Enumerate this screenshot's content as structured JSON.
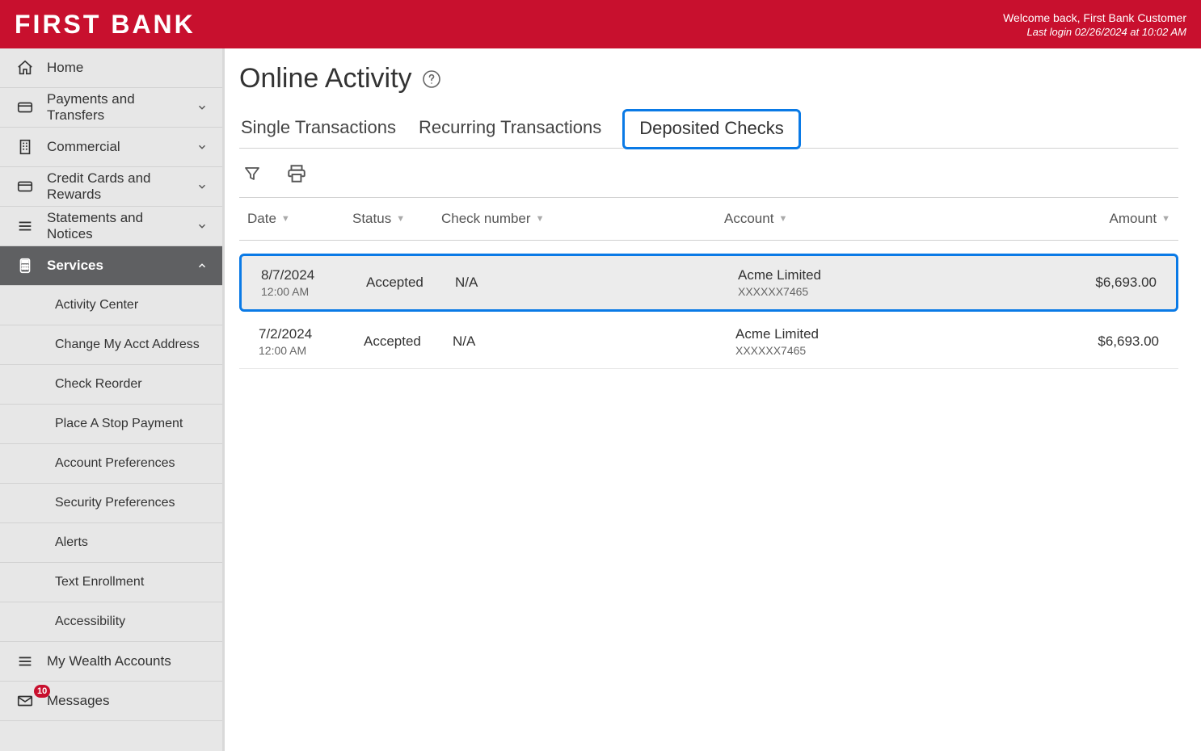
{
  "brand": "FIRST BANK",
  "header": {
    "welcome": "Welcome back, First Bank Customer",
    "last_login": "Last login 02/26/2024 at 10:02 AM"
  },
  "sidebar": {
    "items": [
      {
        "id": "home",
        "label": "Home",
        "icon": "home",
        "expandable": false
      },
      {
        "id": "payments",
        "label": "Payments and Transfers",
        "icon": "card",
        "expandable": true,
        "expanded": false
      },
      {
        "id": "commercial",
        "label": "Commercial",
        "icon": "building",
        "expandable": true,
        "expanded": false
      },
      {
        "id": "credit",
        "label": "Credit Cards and Rewards",
        "icon": "card",
        "expandable": true,
        "expanded": false
      },
      {
        "id": "statements",
        "label": "Statements and Notices",
        "icon": "lines",
        "expandable": true,
        "expanded": false
      },
      {
        "id": "services",
        "label": "Services",
        "icon": "calculator",
        "expandable": true,
        "expanded": true,
        "active": true,
        "children": [
          {
            "id": "activity-center",
            "label": "Activity Center"
          },
          {
            "id": "change-address",
            "label": "Change My Acct Address"
          },
          {
            "id": "check-reorder",
            "label": "Check Reorder"
          },
          {
            "id": "stop-payment",
            "label": "Place A Stop Payment"
          },
          {
            "id": "acct-pref",
            "label": "Account Preferences"
          },
          {
            "id": "security-pref",
            "label": "Security Preferences"
          },
          {
            "id": "alerts",
            "label": "Alerts"
          },
          {
            "id": "text-enroll",
            "label": "Text Enrollment"
          },
          {
            "id": "accessibility",
            "label": "Accessibility"
          }
        ]
      },
      {
        "id": "wealth",
        "label": "My Wealth Accounts",
        "icon": "lines",
        "expandable": false
      },
      {
        "id": "messages",
        "label": "Messages",
        "icon": "envelope",
        "expandable": false,
        "badge": "10"
      }
    ]
  },
  "page": {
    "title": "Online Activity",
    "tabs": [
      {
        "id": "single",
        "label": "Single Transactions",
        "active": false
      },
      {
        "id": "recurring",
        "label": "Recurring Transactions",
        "active": false
      },
      {
        "id": "deposited",
        "label": "Deposited Checks",
        "active": true
      }
    ],
    "columns": [
      {
        "id": "date",
        "label": "Date"
      },
      {
        "id": "status",
        "label": "Status"
      },
      {
        "id": "check",
        "label": "Check number"
      },
      {
        "id": "account",
        "label": "Account"
      },
      {
        "id": "amount",
        "label": "Amount"
      }
    ],
    "rows": [
      {
        "selected": true,
        "date": "8/7/2024",
        "time": "12:00 AM",
        "status": "Accepted",
        "check": "N/A",
        "account_name": "Acme Limited",
        "account_num": "XXXXXX7465",
        "amount": "$6,693.00"
      },
      {
        "selected": false,
        "date": "7/2/2024",
        "time": "12:00 AM",
        "status": "Accepted",
        "check": "N/A",
        "account_name": "Acme Limited",
        "account_num": "XXXXXX7465",
        "amount": "$6,693.00"
      }
    ]
  }
}
